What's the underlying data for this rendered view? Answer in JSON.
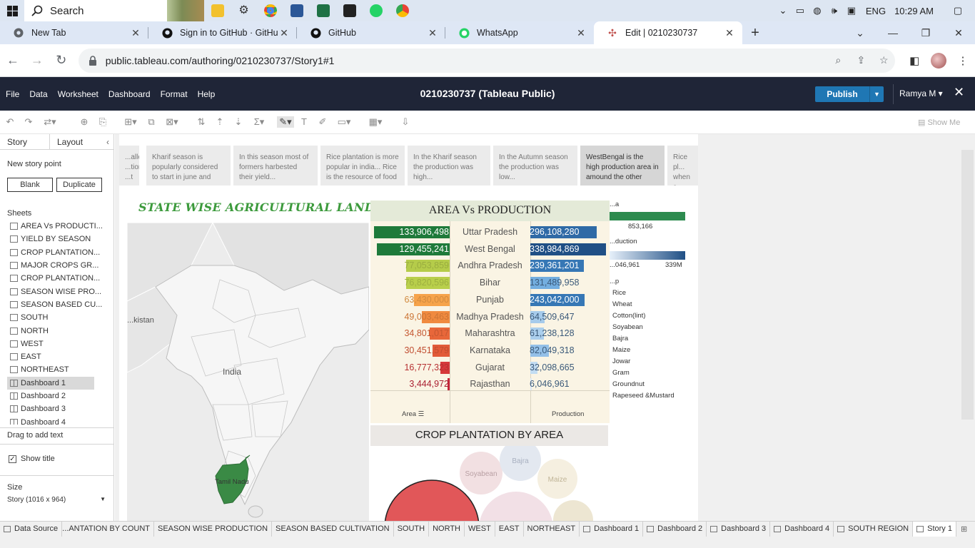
{
  "taskbar": {
    "search_placeholder": "Search",
    "lang": "ENG",
    "time": "10:29 AM"
  },
  "browser": {
    "tabs": [
      {
        "label": "New Tab",
        "icon": "chrome-icon"
      },
      {
        "label": "Sign in to GitHub · GitHub",
        "icon": "github-icon"
      },
      {
        "label": "GitHub",
        "icon": "github-icon"
      },
      {
        "label": "WhatsApp",
        "icon": "whatsapp-icon"
      },
      {
        "label": "Edit | 0210230737",
        "icon": "tableau-icon"
      }
    ],
    "url": "public.tableau.com/authoring/0210230737/Story1#1"
  },
  "tableau": {
    "menu": [
      "File",
      "Data",
      "Worksheet",
      "Dashboard",
      "Format",
      "Help"
    ],
    "title": "0210230737 (Tableau Public)",
    "publish": "Publish",
    "user": "Ramya M ▾",
    "show_me": "Show Me"
  },
  "left_panel": {
    "tab_story": "Story",
    "tab_layout": "Layout",
    "new_story_point": "New story point",
    "blank": "Blank",
    "duplicate": "Duplicate",
    "sheets_heading": "Sheets",
    "sheets": [
      {
        "label": "AREA Vs PRODUCTI...",
        "type": "sheet"
      },
      {
        "label": "YIELD BY SEASON",
        "type": "sheet"
      },
      {
        "label": "CROP PLANTATION...",
        "type": "sheet"
      },
      {
        "label": "MAJOR CROPS GR...",
        "type": "sheet"
      },
      {
        "label": "CROP PLANTATION...",
        "type": "sheet"
      },
      {
        "label": "SEASON WISE PRO...",
        "type": "sheet"
      },
      {
        "label": "SEASON BASED CU...",
        "type": "sheet"
      },
      {
        "label": "SOUTH",
        "type": "sheet"
      },
      {
        "label": "NORTH",
        "type": "sheet"
      },
      {
        "label": "WEST",
        "type": "sheet"
      },
      {
        "label": "EAST",
        "type": "sheet"
      },
      {
        "label": "NORTHEAST",
        "type": "sheet"
      },
      {
        "label": "Dashboard 1",
        "type": "dashboard"
      },
      {
        "label": "Dashboard 2",
        "type": "dashboard"
      },
      {
        "label": "Dashboard 3",
        "type": "dashboard"
      },
      {
        "label": "Dashboard 4",
        "type": "dashboard"
      }
    ],
    "drag_to_add_text": "Drag to add text",
    "show_title": "Show title",
    "size_heading": "Size",
    "size_value": "Story (1016 x 964)"
  },
  "story_points": [
    "...aller ...tion ...t",
    "Kharif season is popularly considered to start in june and",
    "In this season most of formers harbested their yield...",
    "Rice plantation is more popular in india... Rice is the resource of food",
    "In the Kharif season the production was high...",
    "In the Autumn season the production was low...",
    "WestBengal is the high production area in amound the other",
    "Rice pl... when c... cultiva..."
  ],
  "map": {
    "title": "STATE WISE AGRICULTURAL LAND",
    "labels": {
      "pakistan": "...kistan",
      "india": "India",
      "tamil_nadu": "Tamil Nadu"
    },
    "highlight_color": "#3a8a45"
  },
  "area_vs_production": {
    "title": "AREA Vs PRODUCTION",
    "x_area_label": "Area",
    "x_production_label": "Production",
    "rows": [
      {
        "state": "Uttar Pradesh",
        "area": "133,906,498",
        "area_value": 133906498,
        "production": "296,108,280",
        "production_value": 296108280,
        "area_color": "#1e7a3a",
        "prod_color": "#2f6aa6"
      },
      {
        "state": "West Bengal",
        "area": "129,455,241",
        "area_value": 129455241,
        "production": "338,984,869",
        "production_value": 338984869,
        "area_color": "#1e7a3a",
        "prod_color": "#1f4f85"
      },
      {
        "state": "Andhra Pradesh",
        "area": "77,053,859",
        "area_value": 77053859,
        "production": "239,361,201",
        "production_value": 239361201,
        "area_color": "#b5cc4a",
        "prod_color": "#3677b5"
      },
      {
        "state": "Bihar",
        "area": "76,820,596",
        "area_value": 76820596,
        "production": "131,489,958",
        "production_value": 131489958,
        "area_color": "#b9cf4b",
        "prod_color": "#73aee0"
      },
      {
        "state": "Punjab",
        "area": "63,430,000",
        "area_value": 63430000,
        "production": "243,042,000",
        "production_value": 243042000,
        "area_color": "#f6a34a",
        "prod_color": "#3677b5"
      },
      {
        "state": "Madhya Pradesh",
        "area": "49,003,463",
        "area_value": 49003463,
        "production": "64,509,647",
        "production_value": 64509647,
        "area_color": "#f08a3f",
        "prod_color": "#a6cbeb"
      },
      {
        "state": "Maharashtra",
        "area": "34,801,017",
        "area_value": 34801017,
        "production": "61,238,128",
        "production_value": 61238128,
        "area_color": "#e8673a",
        "prod_color": "#abcfed"
      },
      {
        "state": "Karnataka",
        "area": "30,451,579",
        "area_value": 30451579,
        "production": "82,049,318",
        "production_value": 82049318,
        "area_color": "#e25a38",
        "prod_color": "#94c0e8"
      },
      {
        "state": "Gujarat",
        "area": "16,777,323",
        "area_value": 16777323,
        "production": "32,098,665",
        "production_value": 32098665,
        "area_color": "#d6383a",
        "prod_color": "#c2dcf2"
      },
      {
        "state": "Rajasthan",
        "area": "3,444,972",
        "area_value": 3444972,
        "production": "6,046,961",
        "production_value": 6046961,
        "area_color": "#c8253a",
        "prod_color": "#dce9f6"
      }
    ]
  },
  "legend": {
    "area_title": "...a",
    "area_value": "853,166",
    "production_title": "...duction",
    "prod_min": "...046,961",
    "prod_max": "339M",
    "crop_title": "...p",
    "crops": [
      "Rice",
      "Wheat",
      "Cotton(lint)",
      "Soyabean",
      "Bajra",
      "Maize",
      "Jowar",
      "Gram",
      "Groundnut",
      "Rapeseed &Mustard"
    ]
  },
  "crop_plantation": {
    "title": "CROP PLANTATION BY AREA",
    "bubbles": [
      "Soyabean",
      "Bajra",
      "Maize"
    ]
  },
  "bottom_tabs": [
    {
      "label": "Data Source",
      "type": "datasource"
    },
    {
      "label": "...ANTATION BY COUNT",
      "type": "plain"
    },
    {
      "label": "SEASON WISE PRODUCTION",
      "type": "plain"
    },
    {
      "label": "SEASON BASED CULTIVATION",
      "type": "plain"
    },
    {
      "label": "SOUTH",
      "type": "plain"
    },
    {
      "label": "NORTH",
      "type": "plain"
    },
    {
      "label": "WEST",
      "type": "plain"
    },
    {
      "label": "EAST",
      "type": "plain"
    },
    {
      "label": "NORTHEAST",
      "type": "plain"
    },
    {
      "label": "Dashboard 1",
      "type": "dashboard"
    },
    {
      "label": "Dashboard 2",
      "type": "dashboard"
    },
    {
      "label": "Dashboard 3",
      "type": "dashboard"
    },
    {
      "label": "Dashboard 4",
      "type": "dashboard"
    },
    {
      "label": "SOUTH REGION",
      "type": "dashboard"
    },
    {
      "label": "Story 1",
      "type": "story"
    }
  ]
}
